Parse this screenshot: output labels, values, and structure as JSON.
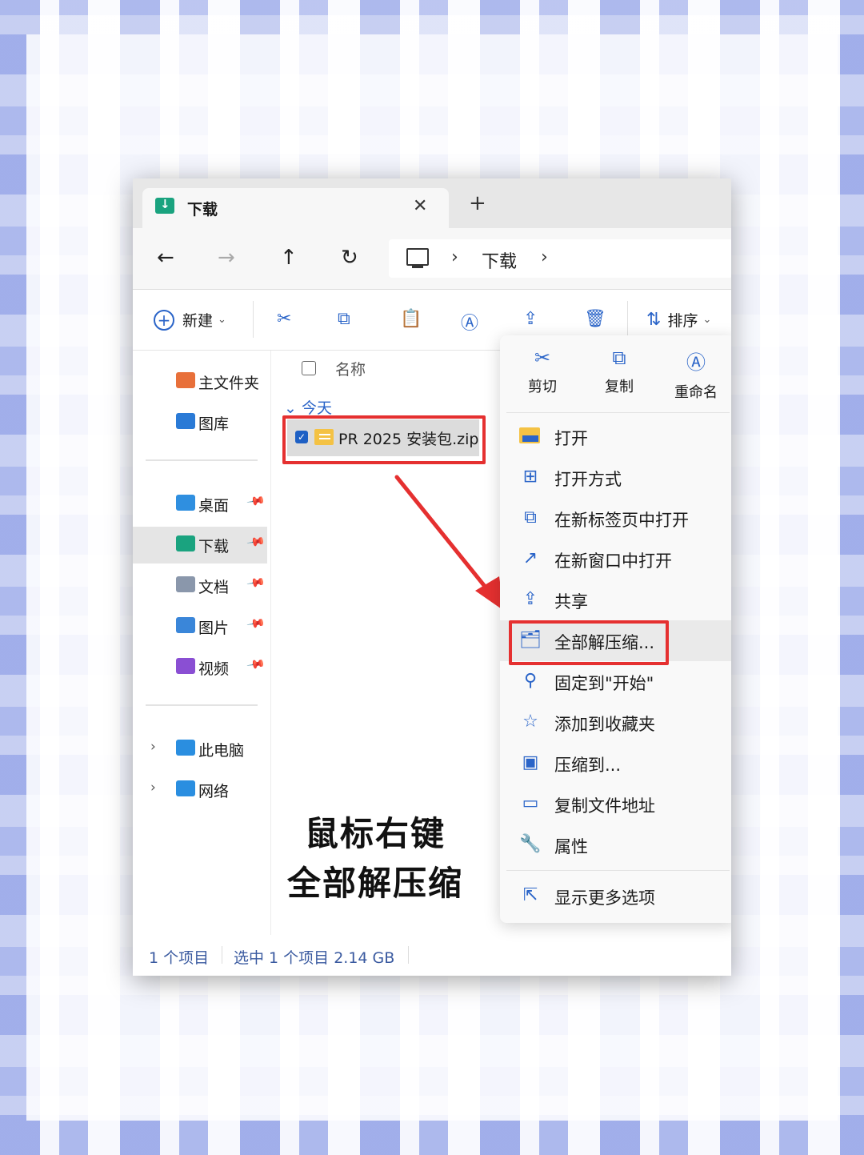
{
  "window": {
    "tab_title": "下载",
    "close_glyph": "✕",
    "new_tab_glyph": "+"
  },
  "nav": {
    "back_glyph": "←",
    "forward_glyph": "→",
    "up_glyph": "↑",
    "refresh_glyph": "↻",
    "breadcrumb_sep": "›",
    "breadcrumb": "下载"
  },
  "toolbar": {
    "new_label": "新建",
    "sort_label": "排序",
    "icons": [
      "cut-icon",
      "copy-icon",
      "paste-icon",
      "rename-icon",
      "share-icon",
      "delete-icon"
    ]
  },
  "sidebar": {
    "items": [
      {
        "label": "主文件夹",
        "icon": "home-icon"
      },
      {
        "label": "图库",
        "icon": "gallery-icon"
      },
      {
        "label": "桌面",
        "icon": "desktop-folder-icon",
        "pinned": true
      },
      {
        "label": "下载",
        "icon": "downloads-folder-icon",
        "pinned": true,
        "selected": true
      },
      {
        "label": "文档",
        "icon": "documents-folder-icon",
        "pinned": true
      },
      {
        "label": "图片",
        "icon": "pictures-folder-icon",
        "pinned": true
      },
      {
        "label": "视频",
        "icon": "videos-folder-icon",
        "pinned": true
      },
      {
        "label": "此电脑",
        "icon": "this-pc-icon",
        "expandable": true
      },
      {
        "label": "网络",
        "icon": "network-icon",
        "expandable": true
      }
    ]
  },
  "content": {
    "column_name": "名称",
    "group": "今天",
    "file": {
      "name": "PR 2025 安装包.zip",
      "selected": true
    },
    "caption_line1": "鼠标右键",
    "caption_line2": "全部解压缩"
  },
  "status": {
    "count": "1 个项目",
    "selection": "选中 1 个项目  2.14 GB"
  },
  "context_menu": {
    "top_actions": [
      {
        "label": "剪切",
        "icon": "cut-icon"
      },
      {
        "label": "复制",
        "icon": "copy-icon"
      },
      {
        "label": "重命名",
        "icon": "rename-icon"
      }
    ],
    "items": [
      {
        "label": "打开",
        "icon": "folder-open-icon"
      },
      {
        "label": "打开方式",
        "icon": "open-with-icon"
      },
      {
        "label": "在新标签页中打开",
        "icon": "new-tab-icon"
      },
      {
        "label": "在新窗口中打开",
        "icon": "new-window-icon"
      },
      {
        "label": "共享",
        "icon": "share-icon"
      },
      {
        "label": "全部解压缩...",
        "icon": "extract-all-icon",
        "highlighted": true
      },
      {
        "label": "固定到\"开始\"",
        "icon": "pin-icon"
      },
      {
        "label": "添加到收藏夹",
        "icon": "star-icon"
      },
      {
        "label": "压缩到...",
        "icon": "compress-icon"
      },
      {
        "label": "复制文件地址",
        "icon": "copy-path-icon"
      },
      {
        "label": "属性",
        "icon": "wrench-icon"
      }
    ],
    "more_label": "显示更多选项"
  },
  "colors": {
    "accent": "#2a64c8",
    "highlight_border": "#e53030",
    "folder_yellow": "#f4c244",
    "downloads_green": "#1aa37f"
  }
}
